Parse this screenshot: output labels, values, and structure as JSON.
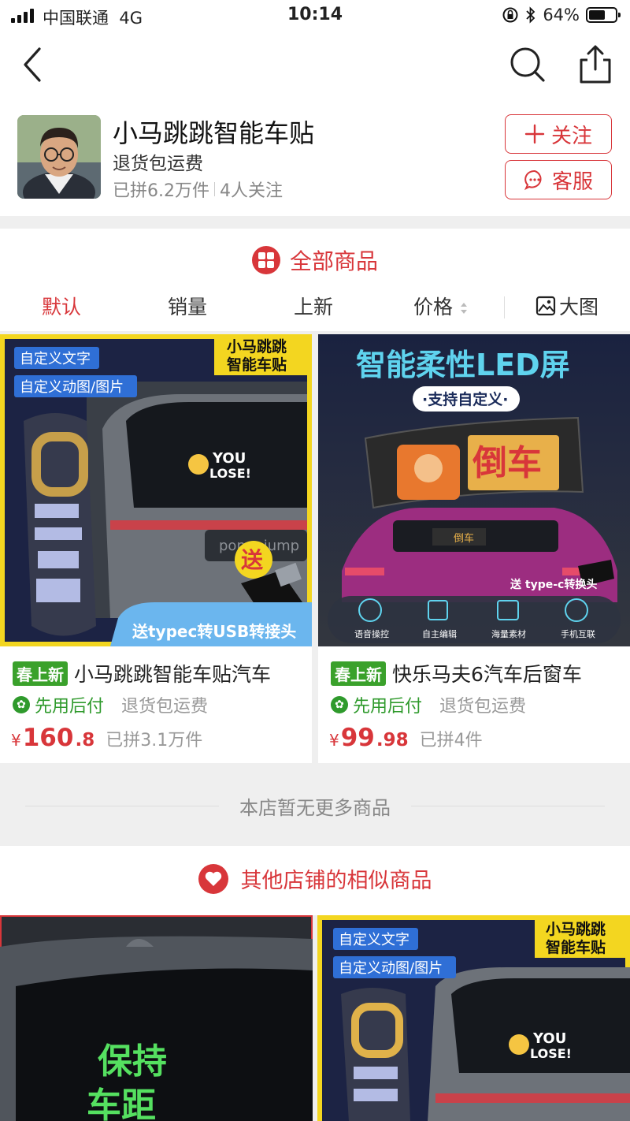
{
  "status_bar": {
    "carrier": "中国联通",
    "network": "4G",
    "time": "10:14",
    "battery": "64%",
    "battery_level": 0.64
  },
  "shop": {
    "name": "小马跳跳智能车贴",
    "tagline": "退货包运费",
    "sold": "已拼6.2万件",
    "followers": "4人关注",
    "follow_label": "关注",
    "service_label": "客服"
  },
  "section_all": {
    "title": "全部商品",
    "tabs": [
      "默认",
      "销量",
      "上新",
      "价格",
      "大图"
    ]
  },
  "products": [
    {
      "badge": "春上新",
      "title": "小马跳跳智能车贴汽车",
      "pay": "先用后付",
      "shipping": "退货包运费",
      "currency": "¥",
      "price_int": "160",
      "price_dec": ".8",
      "sold": "已拼3.1万件",
      "image_text": {
        "tag1": "自定义文字",
        "tag2": "自定义动图/图片",
        "brand_line1": "小马跳跳",
        "brand_line2": "智能车贴",
        "you": "YOU",
        "lose": "LOSE!",
        "gift": "送",
        "footer": "送typec转USB转接头"
      }
    },
    {
      "badge": "春上新",
      "title": "快乐马夫6汽车后窗车",
      "pay": "先用后付",
      "shipping": "退货包运费",
      "currency": "¥",
      "price_int": "99",
      "price_dec": ".98",
      "sold": "已拼4件",
      "image_text": {
        "headline": "智能柔性LED屏",
        "sub": "·支持自定义·",
        "panel": "倒车",
        "plate": "倒车",
        "gift": "送 type-c转换头",
        "features": [
          "语音操控",
          "自主编辑",
          "海量素材",
          "手机互联"
        ]
      }
    }
  ],
  "no_more": "本店暂无更多商品",
  "section_similar": {
    "title": "其他店铺的相似商品"
  },
  "similar_products": [
    {
      "image_text": {
        "green_line1": "保持",
        "green_line2": "车距"
      }
    },
    {
      "image_text": {
        "tag1": "自定义文字",
        "tag2": "自定义动图/图片",
        "brand_line1": "小马跳跳",
        "brand_line2": "智能车贴",
        "you": "YOU",
        "lose": "LOSE!"
      }
    }
  ],
  "colors": {
    "accent": "#d8363a",
    "green": "#2f9a2c",
    "page_bg": "#efefef"
  }
}
